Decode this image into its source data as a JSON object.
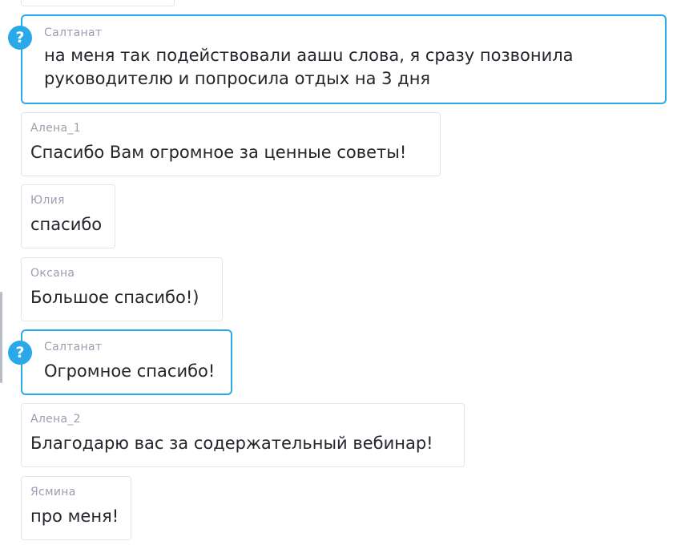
{
  "messages": [
    {
      "author": "",
      "text": "",
      "type": "partial"
    },
    {
      "author": "Салтанат",
      "text": "на меня так подействовали аашu слова, я сразу позвонила руководителю и попросила отдых на 3 дня",
      "text_line1": "на меня так подействовали аашu слова, я сразу позвонила",
      "text_line2": "руководителю и попросила отдых на 3 дня",
      "type": "question",
      "badge": "?"
    },
    {
      "author": "Алена_1",
      "text": "Спасибо Вам огромное за ценные советы!",
      "type": "regular"
    },
    {
      "author": "Юлия",
      "text": "спасибо",
      "type": "regular"
    },
    {
      "author": "Оксана",
      "text": "Большое спасибо!)",
      "type": "regular"
    },
    {
      "author": "Салтанат",
      "text": "Огромное спасибо!",
      "type": "question",
      "badge": "?"
    },
    {
      "author": "Алена_2",
      "text": "Благодарю вас за содержательный вебинар!",
      "type": "regular"
    },
    {
      "author": "Ясмина",
      "text": "про меня!",
      "type": "regular"
    }
  ],
  "colors": {
    "question_border": "#29a9e9",
    "author_text": "#9b9eae",
    "message_text": "#23262b",
    "card_border": "#e4e6ea"
  },
  "icons": {
    "question_badge": "question-mark-icon"
  }
}
